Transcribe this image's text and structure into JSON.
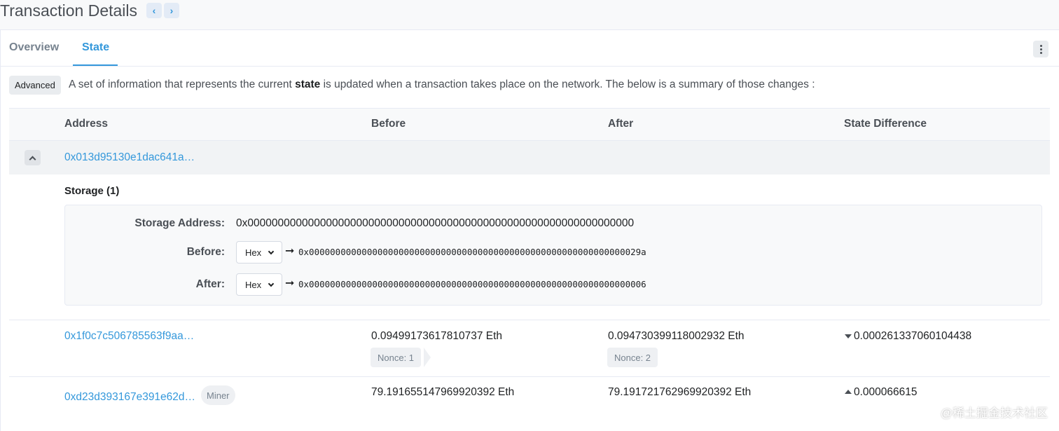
{
  "header": {
    "title": "Transaction Details",
    "prev_icon": "chevron-left-icon",
    "next_icon": "chevron-right-icon",
    "prev": "‹",
    "next": "›"
  },
  "tabs": [
    {
      "label": "Overview",
      "active": false
    },
    {
      "label": "State",
      "active": true
    }
  ],
  "toolbar": {
    "advanced_label": "Advanced",
    "more_icon": "more-vertical-icon"
  },
  "description": {
    "before": "A set of information that represents the current ",
    "bold": "state",
    "after": " is updated when a transaction takes place on the network. The below is a summary of those changes :"
  },
  "table": {
    "columns": [
      "Address",
      "Before",
      "After",
      "State Difference"
    ],
    "expanded_row": {
      "address": "0x013d95130e1dac641a…",
      "storage_title": "Storage (1)",
      "storage_address_label": "Storage Address:",
      "storage_address": "0x0000000000000000000000000000000000000000000000000000000000000000",
      "before_label": "Before:",
      "after_label": "After:",
      "before_format": "Hex",
      "after_format": "Hex",
      "arrow": "➞",
      "before_value": "0x000000000000000000000000000000000000000000000000000000000000029a",
      "after_value": "0x0000000000000000000000000000000000000000000000000000000000000006"
    },
    "rows": [
      {
        "address": "0x1f0c7c506785563f9aa…",
        "before": "0.09499173617810737 Eth",
        "before_nonce": "Nonce: 1",
        "after": "0.094730399118002932 Eth",
        "after_nonce": "Nonce: 2",
        "difference": "0.000261337060104438",
        "direction": "down"
      },
      {
        "address": "0xd23d393167e391e62d…",
        "badge": "Miner",
        "before": "79.191655147969920392 Eth",
        "after": "79.191721762969920392 Eth",
        "difference": "0.000066615",
        "direction": "up"
      }
    ]
  },
  "watermark": "@稀土掘金技术社区",
  "colors": {
    "link": "#3498db",
    "text": "#1e2022",
    "muted": "#77838f",
    "border": "#e7eaf3"
  }
}
